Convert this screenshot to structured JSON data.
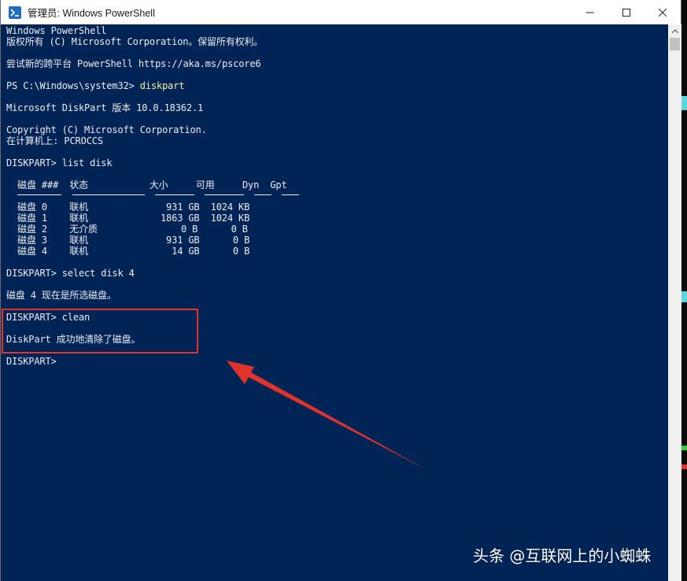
{
  "window": {
    "title": "管理员: Windows PowerShell",
    "minimize_glyph": "—",
    "maximize_glyph": "☐",
    "close_glyph": "✕"
  },
  "console": {
    "lines": [
      "Windows PowerShell",
      "版权所有 (C) Microsoft Corporation。保留所有权利。",
      "尝试新的跨平台 PowerShell https://aka.ms/pscore6",
      "PS C:\\Windows\\system32> ",
      "diskpart",
      "Microsoft DiskPart 版本 10.0.18362.1",
      "Copyright (C) Microsoft Corporation.",
      "在计算机上: PCROCCS",
      "DISKPART> list disk",
      "  磁盘 ###  状态           大小     可用     Dyn  Gpt",
      "  磁盘 0    联机              931 GB  1024 KB",
      "  磁盘 1    联机             1863 GB  1024 KB",
      "  磁盘 2    无介质               0 B      0 B",
      "  磁盘 3    联机              931 GB      0 B",
      "  磁盘 4    联机               14 GB      0 B",
      "DISKPART> select disk 4",
      "磁盘 4 现在是所选磁盘。",
      "DISKPART> clean",
      "DiskPart 成功地清除了磁盘。",
      "DISKPART> "
    ]
  },
  "colors": {
    "console_bg": "#012456",
    "console_text": "#eeedf0",
    "command_text": "#f3f1a2",
    "annotation_red": "#e0332c"
  },
  "watermark": "头条 @互联网上的小蜘蛛"
}
